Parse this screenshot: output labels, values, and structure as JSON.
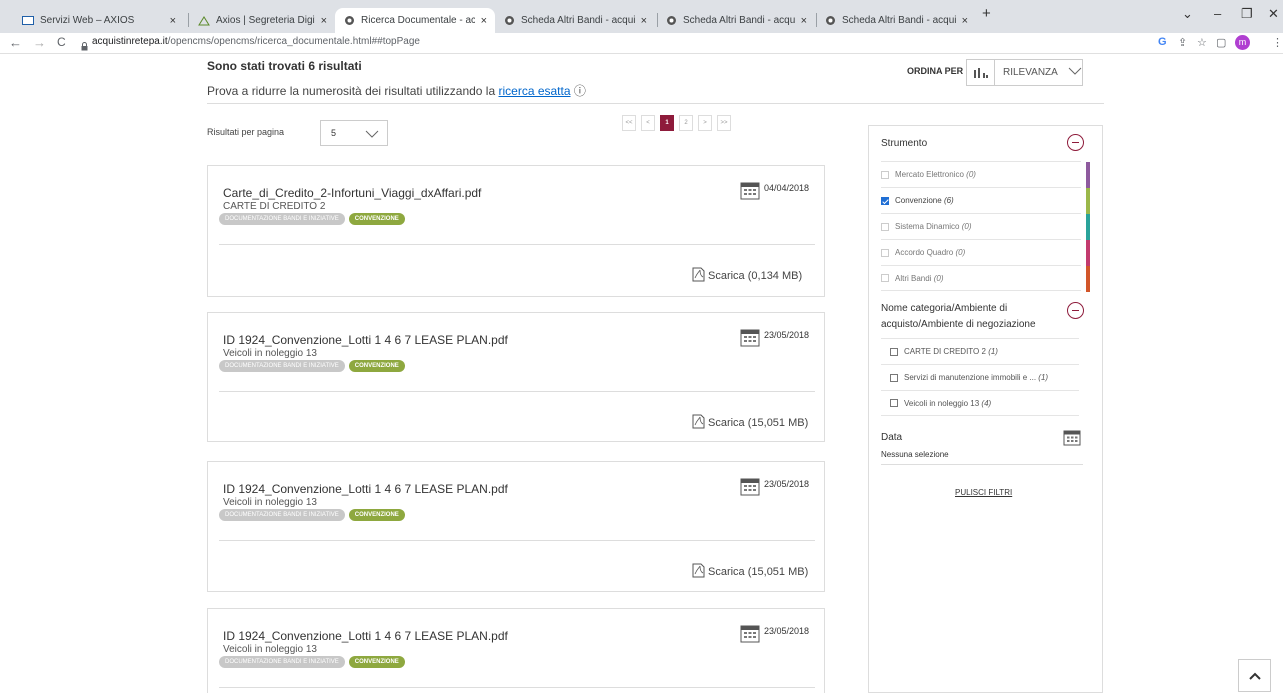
{
  "browser": {
    "tabs": [
      {
        "label": "Servizi Web – AXIOS",
        "close": "×"
      },
      {
        "label": "Axios | Segreteria Digitale",
        "close": "×"
      },
      {
        "label": "Ricerca Documentale - acquistin",
        "close": "×"
      },
      {
        "label": "Scheda Altri Bandi - acquistinret",
        "close": "×"
      },
      {
        "label": "Scheda Altri Bandi - acquistinret",
        "close": "×"
      },
      {
        "label": "Scheda Altri Bandi - acquistinret",
        "close": "×"
      }
    ],
    "new_tab": "+",
    "window_controls": {
      "dropdown": "⌄",
      "minimize": "–",
      "restore": "❐",
      "close": "✕"
    },
    "nav": {
      "back": "←",
      "forward": "→",
      "reload": "C"
    },
    "url_host": "acquistinretepa.it",
    "url_path": "/opencms/opencms/ricerca_documentale.html##topPage",
    "profile_initial": "m",
    "toolbar_icons": [
      "google-icon",
      "share-icon",
      "star-icon",
      "sidepanel-icon",
      "profile-icon",
      "menu-icon"
    ]
  },
  "results": {
    "found": "Sono stati trovati 6 risultati",
    "hint_prefix": "Prova a ridurre la numerosità dei risultati utilizzando la",
    "hint_link": "ricerca esatta",
    "hint_info": "ⓘ"
  },
  "sort": {
    "label": "ORDINA PER",
    "value": "RILEVANZA"
  },
  "per_page": {
    "label": "Risultati per pagina",
    "value": "5"
  },
  "pager": {
    "first": "<<",
    "prev": "<",
    "pages": [
      "1",
      "2"
    ],
    "current": "1",
    "next": ">",
    "last": ">>"
  },
  "cards": [
    {
      "title": "Carte_di_Credito_2-Infortuni_Viaggi_dxAffari.pdf",
      "subtitle": "CARTE DI CREDITO 2",
      "tag1": "DOCUMENTAZIONE BANDI E INIZIATIVE",
      "tag2": "CONVENZIONE",
      "date": "04/04/2018",
      "download": "Scarica (0,134 MB)"
    },
    {
      "title": "ID 1924_Convenzione_Lotti 1 4 6 7 LEASE PLAN.pdf",
      "subtitle": "Veicoli in noleggio 13",
      "tag1": "DOCUMENTAZIONE BANDI E INIZIATIVE",
      "tag2": "CONVENZIONE",
      "date": "23/05/2018",
      "download": "Scarica (15,051 MB)"
    },
    {
      "title": "ID 1924_Convenzione_Lotti 1 4 6 7 LEASE PLAN.pdf",
      "subtitle": "Veicoli in noleggio 13",
      "tag1": "DOCUMENTAZIONE BANDI E INIZIATIVE",
      "tag2": "CONVENZIONE",
      "date": "23/05/2018",
      "download": "Scarica (15,051 MB)"
    },
    {
      "title": "ID 1924_Convenzione_Lotti 1 4 6 7 LEASE PLAN.pdf",
      "subtitle": "Veicoli in noleggio 13",
      "tag1": "DOCUMENTAZIONE BANDI E INIZIATIVE",
      "tag2": "CONVENZIONE",
      "date": "23/05/2018",
      "download": ""
    }
  ],
  "filters": {
    "strumento": {
      "title": "Strumento",
      "items": [
        {
          "label": "Mercato Elettronico",
          "count": "(0)",
          "checked": false,
          "color": "#8e5a9e"
        },
        {
          "label": "Convenzione",
          "count": "(6)",
          "checked": true,
          "color": "#9bb84a"
        },
        {
          "label": "Sistema Dinamico",
          "count": "(0)",
          "checked": false,
          "color": "#2aa39a"
        },
        {
          "label": "Accordo Quadro",
          "count": "(0)",
          "checked": false,
          "color": "#c23a6e"
        },
        {
          "label": "Altri Bandi",
          "count": "(0)",
          "checked": false,
          "color": "#d2562a"
        }
      ]
    },
    "categoria": {
      "title_line1": "Nome categoria/Ambiente di",
      "title_line2": "acquisto/Ambiente di negoziazione",
      "items": [
        {
          "label": "CARTE DI CREDITO 2",
          "count": "(1)"
        },
        {
          "label": "Servizi di manutenzione immobili e ...",
          "count": "(1)"
        },
        {
          "label": "Veicoli in noleggio 13",
          "count": "(4)"
        }
      ]
    },
    "data": {
      "title": "Data",
      "value": "Nessuna selezione"
    },
    "clear": "PULISCI FILTRI"
  },
  "colors": {
    "accent": "#8e1b3b",
    "tag_green": "#8ea83f",
    "tag_gray": "#c8c8c8",
    "link": "#0066cc"
  }
}
